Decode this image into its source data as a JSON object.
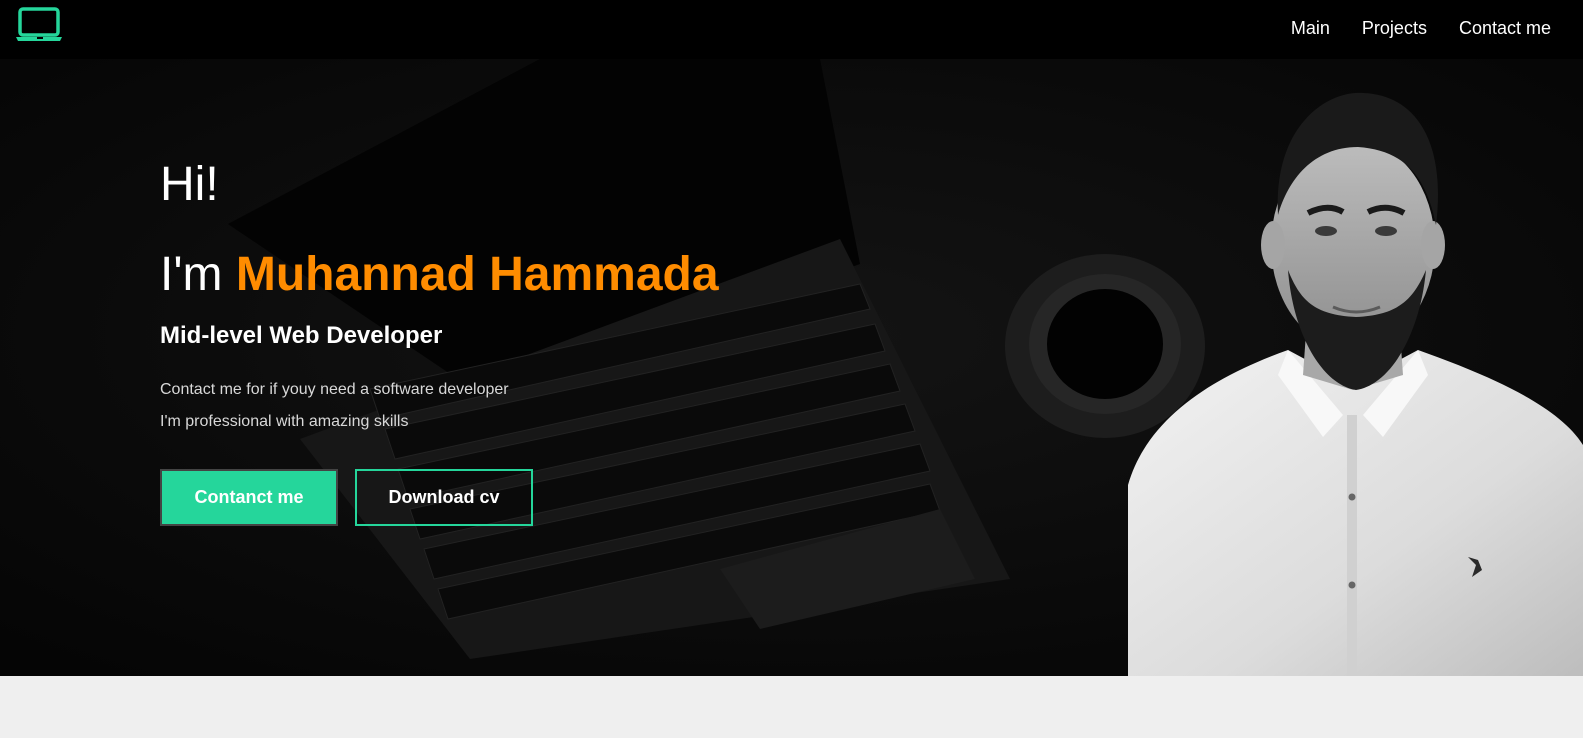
{
  "colors": {
    "accent": "#25d69b",
    "highlight": "#ff8c00",
    "navbar_bg": "#000000",
    "hero_bg": "#060606",
    "lower_bg": "#efefef"
  },
  "navbar": {
    "logo_icon": "laptop-icon",
    "links": [
      "Main",
      "Projects",
      "Contact me"
    ]
  },
  "hero": {
    "greeting": "Hi!",
    "intro_prefix": "I'm",
    "name": "Muhannad Hammada",
    "role": "Mid-level Web Developer",
    "description_lines": [
      "Contact me for if youy need a software developer",
      "I'm professional with amazing skills"
    ],
    "buttons": {
      "contact_label": "Contanct me",
      "download_label": "Download cv"
    }
  }
}
